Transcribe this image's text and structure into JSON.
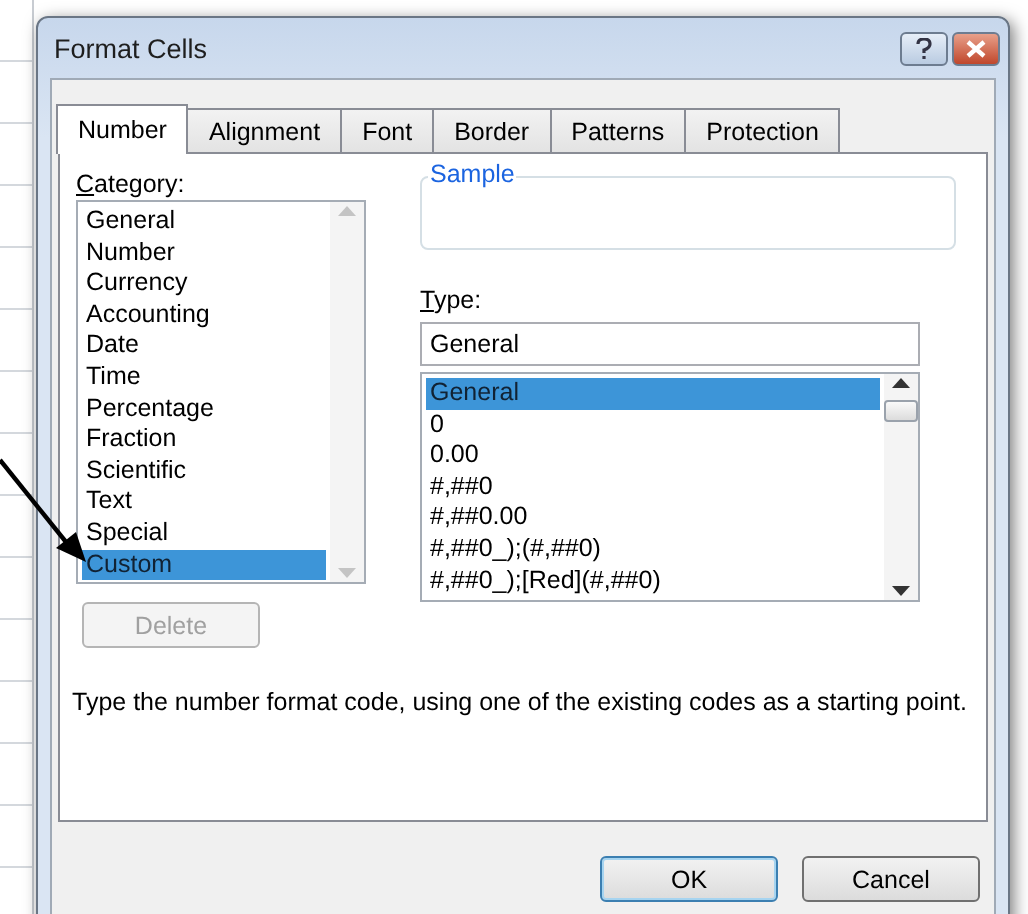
{
  "window": {
    "title": "Format Cells"
  },
  "tabs": [
    {
      "label": "Number",
      "selected": true
    },
    {
      "label": "Alignment",
      "selected": false
    },
    {
      "label": "Font",
      "selected": false
    },
    {
      "label": "Border",
      "selected": false
    },
    {
      "label": "Patterns",
      "selected": false
    },
    {
      "label": "Protection",
      "selected": false
    }
  ],
  "category": {
    "label": "Category:",
    "items": [
      {
        "label": "General",
        "selected": false
      },
      {
        "label": "Number",
        "selected": false
      },
      {
        "label": "Currency",
        "selected": false
      },
      {
        "label": "Accounting",
        "selected": false
      },
      {
        "label": "Date",
        "selected": false
      },
      {
        "label": "Time",
        "selected": false
      },
      {
        "label": "Percentage",
        "selected": false
      },
      {
        "label": "Fraction",
        "selected": false
      },
      {
        "label": "Scientific",
        "selected": false
      },
      {
        "label": "Text",
        "selected": false
      },
      {
        "label": "Special",
        "selected": false
      },
      {
        "label": "Custom",
        "selected": true
      }
    ]
  },
  "delete_button": {
    "label": "Delete",
    "disabled": true
  },
  "sample": {
    "label": "Sample"
  },
  "type": {
    "label": "Type:",
    "value": "General",
    "items": [
      {
        "label": "General",
        "selected": true
      },
      {
        "label": "0",
        "selected": false
      },
      {
        "label": "0.00",
        "selected": false
      },
      {
        "label": "#,##0",
        "selected": false
      },
      {
        "label": "#,##0.00",
        "selected": false
      },
      {
        "label": "#,##0_);(#,##0)",
        "selected": false
      },
      {
        "label": "#,##0_);[Red](#,##0)",
        "selected": false
      }
    ]
  },
  "description": "Type the number format code, using one of the existing codes as a starting point.",
  "buttons": [
    {
      "label": "OK",
      "default": true
    },
    {
      "label": "Cancel",
      "default": false
    }
  ]
}
